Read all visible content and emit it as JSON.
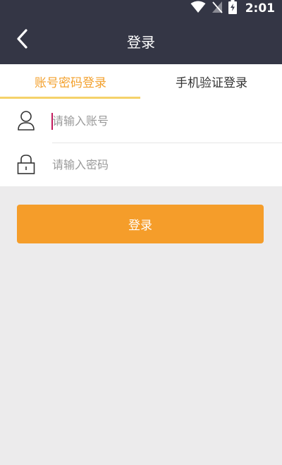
{
  "status_bar": {
    "time": "2:01"
  },
  "app_bar": {
    "title": "登录"
  },
  "tabs": [
    {
      "label": "账号密码登录",
      "active": true
    },
    {
      "label": "手机验证登录",
      "active": false
    }
  ],
  "form": {
    "account": {
      "placeholder": "请输入账号",
      "value": ""
    },
    "password": {
      "placeholder": "请输入密码",
      "value": ""
    }
  },
  "login_button": {
    "label": "登录"
  },
  "icons": {
    "back": "chevron-left-icon",
    "user": "user-icon",
    "lock": "lock-icon",
    "wifi": "wifi-icon",
    "signal": "no-signal-icon",
    "battery": "battery-charging-icon"
  },
  "colors": {
    "header_bg": "#343645",
    "accent": "#f3a12e",
    "tab_underline": "#f5d26a",
    "button_bg": "#f59d2a",
    "page_bg": "#ecebec"
  }
}
